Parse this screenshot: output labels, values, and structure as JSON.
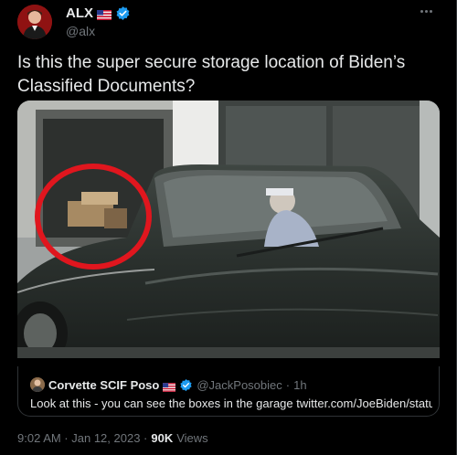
{
  "author": {
    "display_name": "ALX",
    "handle": "@alx",
    "flag_icon": "us-flag-icon",
    "verified_icon": "verified-badge-icon"
  },
  "tweet": {
    "text": "Is this the super secure storage location of Biden’s Classified Documents?",
    "more_icon": "more-options-icon"
  },
  "quoted_tweet": {
    "display_name": "Corvette SCIF Poso",
    "handle": "@JackPosobiec",
    "separator": "·",
    "time": "1h",
    "text": "Look at this - you can see the boxes in the garage twitter.com/JoeBiden/statu..."
  },
  "meta": {
    "timestamp": "9:02 AM · Jan 12, 2023 ·",
    "views_count": "90K",
    "views_label": "Views"
  },
  "colors": {
    "background": "#000000",
    "text_primary": "#e7e9ea",
    "text_secondary": "#71767b",
    "verified": "#1d9bf0",
    "highlight_circle": "#e0161e"
  }
}
